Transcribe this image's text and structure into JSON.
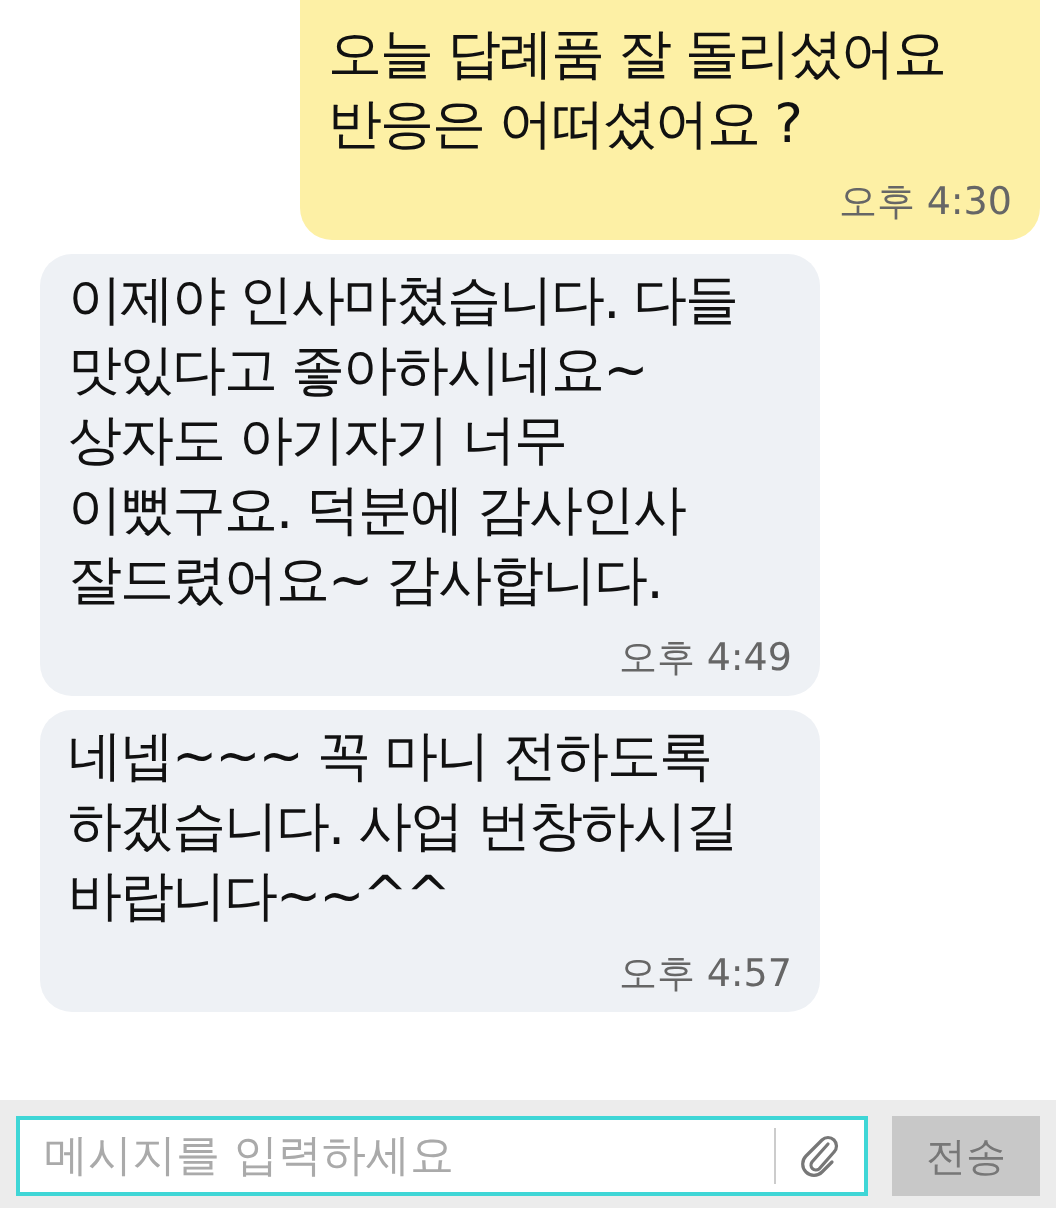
{
  "messages": [
    {
      "kind": "sent",
      "text": "오늘 답례품 잘 돌리셨어요\n반응은  어떠셨어요 ?",
      "time": "오후 4:30"
    },
    {
      "kind": "received",
      "text": "이제야 인사마쳤습니다. 다들\n맛있다고 좋아하시네요~\n상자도 아기자기 너무\n이뻤구요. 덕분에 감사인사\n잘드렸어요~ 감사합니다.",
      "time": "오후 4:49"
    },
    {
      "kind": "received",
      "text": "네넵~~~ 꼭 마니 전하도록\n하겠습니다. 사업 번창하시길\n바랍니다~~^^",
      "time": "오후 4:57"
    }
  ],
  "composer": {
    "placeholder": "메시지를 입력하세요",
    "send": "전송"
  }
}
